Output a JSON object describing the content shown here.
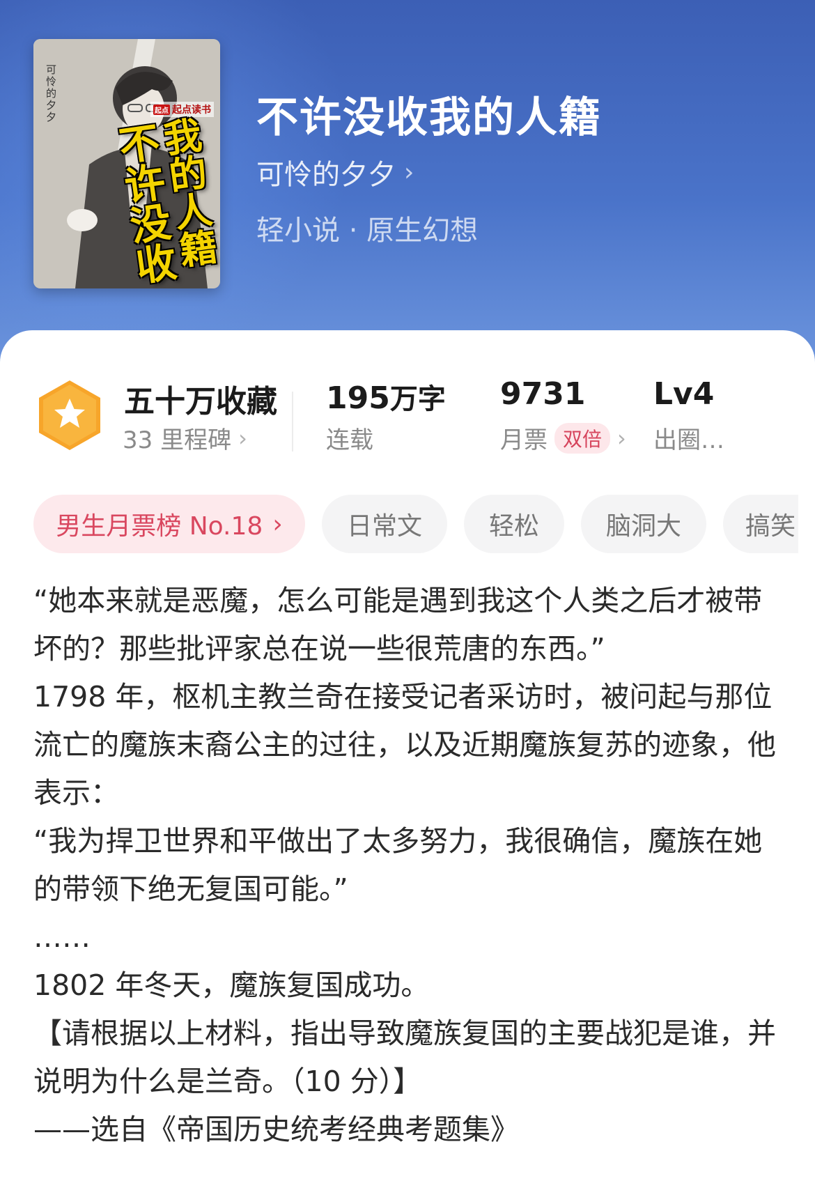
{
  "colors": {
    "header_bg": "#4a73c9",
    "rank_chip_bg": "#fde9ec",
    "rank_chip_text": "#d9475f",
    "badge_orange": "#f7a52a",
    "cover_title_yellow": "#f4d400"
  },
  "cover": {
    "author_text": "可怜的夕夕",
    "brand_mini": "起点",
    "brand": "起点读书",
    "title_left": "不许没收",
    "title_right": "我的人籍"
  },
  "book": {
    "title": "不许没收我的人籍",
    "author": "可怜的夕夕",
    "genre": "轻小说 · 原生幻想"
  },
  "stats": {
    "badge_icon": "star-hexagon-icon",
    "favorites": "五十万收藏",
    "milestones": "33 里程碑",
    "words_number": "195",
    "words_unit": "万字",
    "status": "连载",
    "monthly_votes": "9731",
    "monthly_votes_label": "月票",
    "double_tag": "双倍",
    "level": "Lv4",
    "level_label": "出圈…"
  },
  "tags": {
    "rank": "男生月票榜 No.18",
    "items": [
      "日常文",
      "轻松",
      "脑洞大",
      "搞笑"
    ]
  },
  "description": [
    "“她本来就是恶魔，怎么可能是遇到我这个人类之后才被带坏的？那些批评家总在说一些很荒唐的东西。”",
    "1798 年，枢机主教兰奇在接受记者采访时，被问起与那位流亡的魔族末裔公主的过往，以及近期魔族复苏的迹象，他表示：",
    "“我为捍卫世界和平做出了太多努力，我很确信，魔族在她的带领下绝无复国可能。”",
    "……",
    "1802 年冬天，魔族复国成功。",
    "【请根据以上材料，指出导致魔族复国的主要战犯是谁，并说明为什么是兰奇。（10 分）】",
    "——选自《帝国历史统考经典考题集》"
  ]
}
